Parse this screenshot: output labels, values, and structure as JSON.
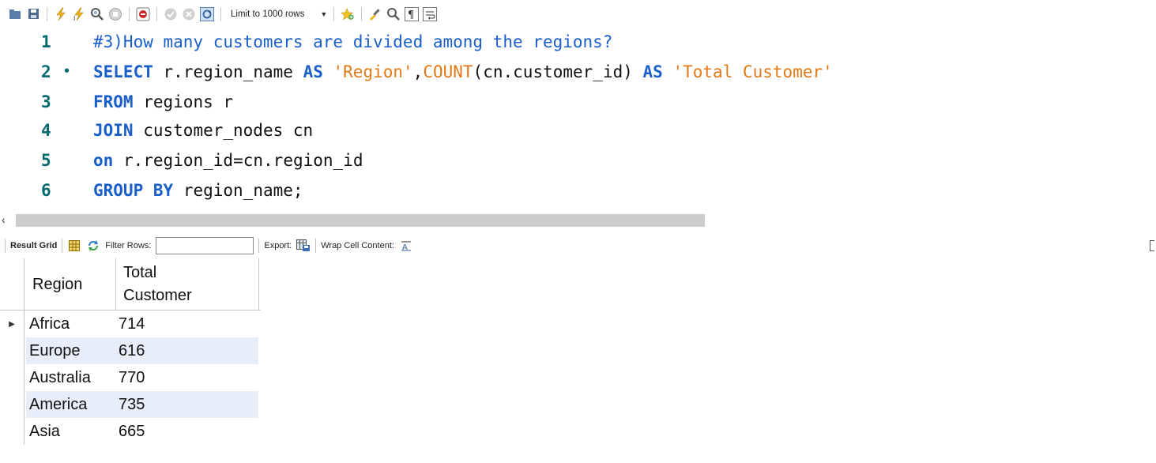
{
  "toolbar": {
    "icons": [
      "open-folder-icon",
      "save-icon",
      "execute-lightning-icon",
      "execute-current-icon",
      "explain-icon",
      "stop-icon",
      "toggle-error-icon",
      "commit-icon",
      "rollback-icon",
      "autocommit-icon",
      "beautify-icon",
      "find-icon",
      "invisible-chars-icon",
      "wrap-icon"
    ],
    "limit_label": "Limit to 1000 rows"
  },
  "editor": {
    "lines": [
      {
        "number": "1",
        "text": "#3)How many customers are divided among the regions?"
      },
      {
        "number": "2",
        "text": "SELECT r.region_name AS 'Region',COUNT(cn.customer_id) AS 'Total Customer'"
      },
      {
        "number": "3",
        "text": "FROM regions r"
      },
      {
        "number": "4",
        "text": "JOIN customer_nodes cn"
      },
      {
        "number": "5",
        "text": "on r.region_id=cn.region_id"
      },
      {
        "number": "6",
        "text": "GROUP BY region_name;"
      }
    ],
    "colors": {
      "keyword": "#1a5fc9",
      "string": "#e07a17",
      "line_number": "#006a6e"
    }
  },
  "result_toolbar": {
    "result_grid_label": "Result Grid",
    "filter_rows_label": "Filter Rows:",
    "filter_value": "",
    "export_label": "Export:",
    "wrap_label": "Wrap Cell Content:"
  },
  "grid": {
    "columns": [
      "Region",
      "Total Customer"
    ],
    "rows": [
      {
        "region": "Africa",
        "total": "714"
      },
      {
        "region": "Europe",
        "total": "616"
      },
      {
        "region": "Australia",
        "total": "770"
      },
      {
        "region": "America",
        "total": "735"
      },
      {
        "region": "Asia",
        "total": "665"
      }
    ],
    "alt_row_color": "#e8eef9"
  }
}
